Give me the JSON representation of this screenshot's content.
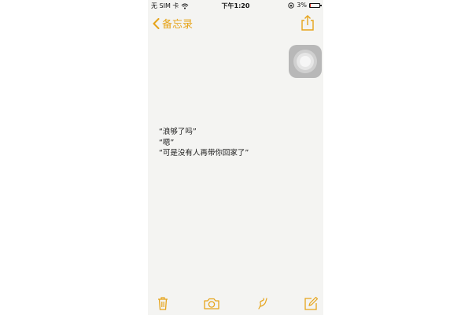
{
  "status_bar": {
    "carrier": "无 SIM 卡",
    "time": "下午1:20",
    "battery_percent": "3%",
    "battery_level": 0.03
  },
  "nav": {
    "back_label": "备忘录",
    "icons": [
      "chevron-left-icon",
      "share-icon"
    ]
  },
  "note": {
    "lines": [
      "“浪够了吗”",
      "“嗯”",
      "“可是没有人再带你回家了”"
    ]
  },
  "toolbar": {
    "icons": [
      "trash-icon",
      "camera-icon",
      "sketch-icon",
      "compose-icon"
    ]
  },
  "colors": {
    "accent": "#e6a41b",
    "paper": "#f4f4f2",
    "battery_low": "#d62d20"
  }
}
